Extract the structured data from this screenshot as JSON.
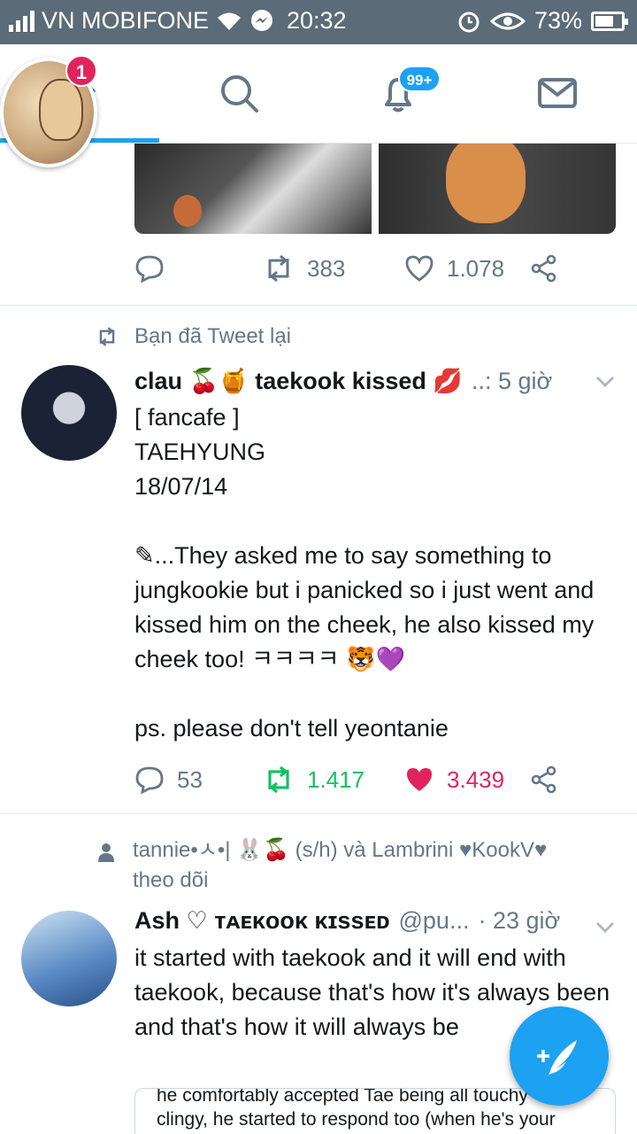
{
  "status_bar": {
    "carrier": "VN MOBIFONE",
    "time": "20:32",
    "battery": "73%",
    "battery_level": 0.73
  },
  "nav": {
    "me_badge": "1",
    "notifications_badge": "99+",
    "tabs": [
      "home-icon",
      "search-icon",
      "bell-icon",
      "mail-icon"
    ],
    "accent_color": "#1da1f2"
  },
  "tweet0": {
    "retweets": "383",
    "likes": "1.078"
  },
  "tweet1": {
    "context": "Bạn đã Tweet lại",
    "name_part1": "clau 🍒🍯 taekook kissed 💋",
    "handle_time": "..: 5 giờ",
    "body": "[ fancafe ]\nTAEHYUNG\n18/07/14\n\n✎...They asked me to say something to jungkookie but i panicked so i just went and kissed him on the cheek, he also kissed my cheek too! ㅋㅋㅋㅋ 🐯💜\n\nps. please don't tell yeontanie",
    "replies": "53",
    "retweets": "1.417",
    "likes": "3.439",
    "retweet_color": "#17bf63",
    "like_color": "#e0245e"
  },
  "tweet2": {
    "context": "tannie•ㅅ•| 🐰🍒 (s/h) và Lambrini ♥KookV♥\ntheo dõi",
    "name": "Ash ♡ ᴛᴀᴇᴋᴏᴏᴋ ᴋɪssᴇᴅ",
    "handle": "@pu...",
    "time": "· 23 giờ",
    "body": "it started with taekook and it will end with taekook, because that's how it's always been and that's how it will always be",
    "quote": "he comfortably accepted Tae being all touchy\nclingy, he started to respond too (when he's your\nhigh and you're always looking at \"Kook\" I know"
  }
}
